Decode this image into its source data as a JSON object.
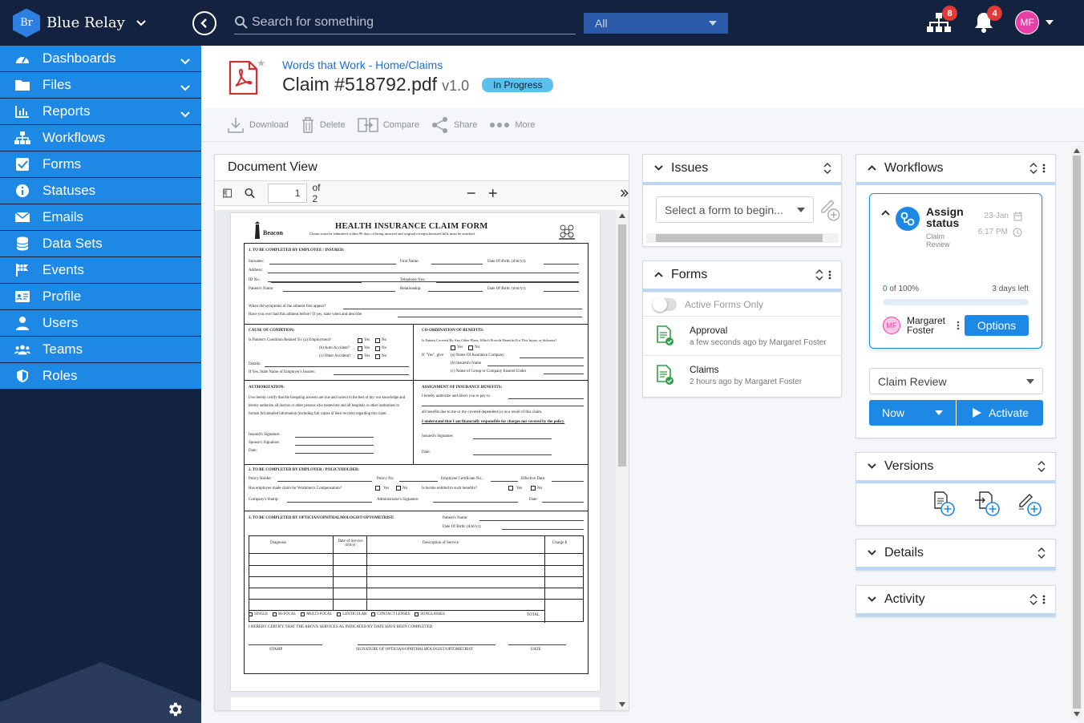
{
  "app": {
    "logo_text": "Br",
    "name": "Blue Relay"
  },
  "search": {
    "placeholder": "Search for something",
    "scope": "All"
  },
  "top_icons": {
    "network_badge": "8",
    "bell_badge": "4",
    "avatar_initials": "MF"
  },
  "sidebar": {
    "items": [
      {
        "label": "Dashboards",
        "icon": "dashboard-icon",
        "expandable": true
      },
      {
        "label": "Files",
        "icon": "folder-icon",
        "expandable": true
      },
      {
        "label": "Reports",
        "icon": "bar-chart-icon",
        "expandable": true
      },
      {
        "label": "Workflows",
        "icon": "sitemap-icon",
        "expandable": false
      },
      {
        "label": "Forms",
        "icon": "checkbox-icon",
        "expandable": false
      },
      {
        "label": "Statuses",
        "icon": "info-icon",
        "expandable": false
      },
      {
        "label": "Emails",
        "icon": "envelope-icon",
        "expandable": false
      },
      {
        "label": "Data Sets",
        "icon": "database-icon",
        "expandable": false
      },
      {
        "label": "Events",
        "icon": "flag-icon",
        "expandable": false
      },
      {
        "label": "Profile",
        "icon": "id-card-icon",
        "expandable": false
      },
      {
        "label": "Users",
        "icon": "user-icon",
        "expandable": false
      },
      {
        "label": "Teams",
        "icon": "team-icon",
        "expandable": false
      },
      {
        "label": "Roles",
        "icon": "shield-icon",
        "expandable": false
      }
    ]
  },
  "header": {
    "breadcrumb": "Words that Work - Home/Claims",
    "title": "Claim #518792.pdf",
    "version": "v1.0",
    "status": "In Progress"
  },
  "toolbar": {
    "download": "Download",
    "delete": "Delete",
    "compare": "Compare",
    "share": "Share",
    "more": "More"
  },
  "document_view": {
    "title": "Document View",
    "page": "1",
    "of_pages": "of 2",
    "form": {
      "brand": "Beacon",
      "title": "HEALTH INSURANCE CLAIM FORM",
      "subtitle": "Claims must be submitted within 90 days of being incurred and original receipts/itemized bills must be attached.",
      "section1": "1.    TO BE COMPLETED BY EMPLOYEE / INSURED:",
      "surname": "Surname:",
      "first_name": "First Name:",
      "dob": "Date Of Birth: (d/m/yr):",
      "address": "Address:",
      "id_no": "ID No.:",
      "telephone": "Telephone Nos.:",
      "patient_name": "Patient's Name:",
      "relationship": "Relationship:",
      "symptoms": "When did symptoms of the ailment first appear?",
      "treated": "Have you ever had this ailment before? If yes, state when and describe",
      "cause": "CAUSE OF CONDITION:",
      "cause_q": "Is Patient's Condition Related To:  (a) Employment?",
      "auto": "(b) Auto Accident?",
      "other": "(c) Other Accident?",
      "details": "Details:",
      "employer_ins": "If Yes, State Name of Employer's Insurer:",
      "coord": "CO-ORDINATION OF BENEFITS:",
      "coord_q": "Is Patient Covered By Any Other Plans, Which Provide Benefits For This Injury or Sickness?",
      "coord_a": "(a)  Name Of Insurance Company",
      "coord_b": "(b)  Insured's Name",
      "coord_c": "(c)  Name of Group or Company Insured Under",
      "authorization": "AUTHORIZATION:",
      "auth_text": "I/we hereby certify that the foregoing answers are true and correct to the best of my/ our knowledge and hereby authorize all doctors or other persons who treated me and all hospitals or other institutions to furnish full detailed information (including full copies of their records) regarding this claim.",
      "insured_sig": "Insured's Signature:",
      "spouse_sig": "Spouse's Signature:",
      "date": "Date:",
      "assignment": "ASSIGNMENT OF INSURANCE BENEFITS:",
      "assign_text": "I hereby authorize and direct you to pay to",
      "assign_text2": "all benefits due to me or my covered dependent (s) as a result of this claim.",
      "assign_bold": "I understand that I am financially responsible for charges not covered by the policy.",
      "section2": "2.  TO BE COMPLETED BY EMPLOYER / POLICYHOLDER:",
      "policy_holder": "Policy Holder:",
      "policy_no": "Policy No:",
      "emp_cert": "Employee Certificate No.:",
      "eff_date": "Effective Date:",
      "workmen": "Has employee made claim for Workmen's Compensation?",
      "entitled": "Is he/she entitled to such benefits?",
      "stamp": "Company's Stamp:",
      "admin_sig": "Administrator's Signature:",
      "section3": "3.   TO BE COMPLETED BY OPTICIAN/OPHTHALMOLOGIST/OPTOMETRIST:",
      "patients_name": "Patient's Name:",
      "col_diag": "Diagnosis",
      "col_date": "Date of Service d/m/yr",
      "col_desc": "Description of Service",
      "col_charge": "Charge $",
      "lens": [
        "SINGLE",
        "BI-FOCAL",
        "MULTI-FOCAL",
        "LENTICULAR",
        "CONTACT LENSES",
        "SUNGLASSES"
      ],
      "total": "TOTAL",
      "certify": "I HEREBY CERTIFY THAT THE ABOVE SERVICES AS INDICATED BY DATE HAVE BEEN COMPLETED",
      "sig_stamp": "STAMP",
      "sig_opt": "SIGNATURE OF OPTICIAN/OPHTHALMOLOGIST/OPTOMETRIST",
      "sig_date": "DATE",
      "yes": "Yes",
      "no": "No",
      "if_yes_give": "If \"Yes\", give"
    }
  },
  "issues": {
    "title": "Issues",
    "select_placeholder": "Select a form to begin..."
  },
  "forms": {
    "title": "Forms",
    "toggle_label": "Active Forms Only",
    "items": [
      {
        "name": "Approval",
        "meta": "a few seconds ago by Margaret Foster"
      },
      {
        "name": "Claims",
        "meta": "2 hours ago by Margaret Foster"
      }
    ]
  },
  "workflows": {
    "title": "Workflows",
    "card": {
      "title": "Assign status",
      "subtitle": "Claim Review",
      "date": "23-Jan",
      "time": "6:17 PM",
      "progress_value": "0",
      "progress_suffix": " of 100%",
      "progress_fraction": 0,
      "days_left": "3 days left",
      "user_initials": "MF",
      "user_name": "Margaret Foster",
      "options_label": "Options"
    },
    "dropdown_value": "Claim Review",
    "now_label": "Now",
    "activate_label": "Activate"
  },
  "versions": {
    "title": "Versions"
  },
  "details": {
    "title": "Details"
  },
  "activity": {
    "title": "Activity"
  },
  "colors": {
    "navy": "#13223e",
    "accent": "#1e88e5",
    "status": "#5bc0eb",
    "pdf_red": "#d32f2f",
    "badge": "#e53935"
  }
}
